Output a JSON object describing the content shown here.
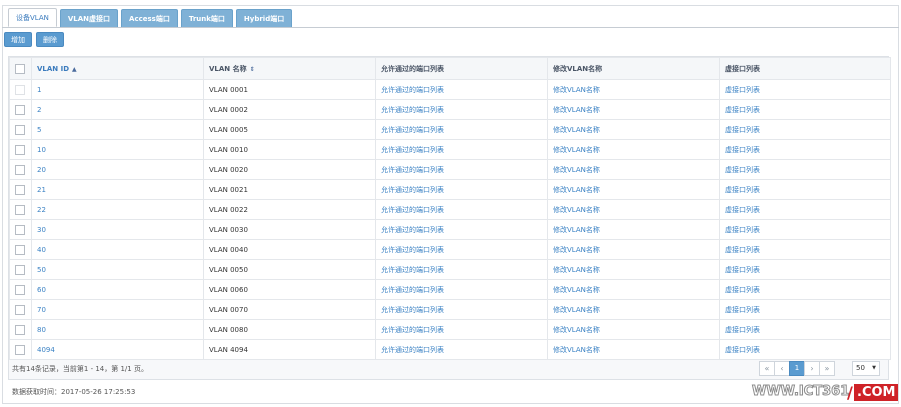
{
  "tabs": [
    "设备VLAN",
    "VLAN虚接口",
    "Access端口",
    "Trunk端口",
    "Hybrid端口"
  ],
  "toolbar": {
    "add": "增加",
    "delete": "删除"
  },
  "table": {
    "headers": [
      "VLAN ID",
      "VLAN 名称",
      "允许通过的端口列表",
      "修改VLAN名称",
      "虚接口列表"
    ],
    "sort_icons": [
      "▲",
      "⇕"
    ],
    "rows": [
      {
        "id": "1",
        "name": "VLAN 0001",
        "ports": "允许通过的端口列表",
        "edit": "修改VLAN名称",
        "vif": "虚接口列表"
      },
      {
        "id": "2",
        "name": "VLAN 0002",
        "ports": "允许通过的端口列表",
        "edit": "修改VLAN名称",
        "vif": "虚接口列表"
      },
      {
        "id": "5",
        "name": "VLAN 0005",
        "ports": "允许通过的端口列表",
        "edit": "修改VLAN名称",
        "vif": "虚接口列表"
      },
      {
        "id": "10",
        "name": "VLAN 0010",
        "ports": "允许通过的端口列表",
        "edit": "修改VLAN名称",
        "vif": "虚接口列表"
      },
      {
        "id": "20",
        "name": "VLAN 0020",
        "ports": "允许通过的端口列表",
        "edit": "修改VLAN名称",
        "vif": "虚接口列表"
      },
      {
        "id": "21",
        "name": "VLAN 0021",
        "ports": "允许通过的端口列表",
        "edit": "修改VLAN名称",
        "vif": "虚接口列表"
      },
      {
        "id": "22",
        "name": "VLAN 0022",
        "ports": "允许通过的端口列表",
        "edit": "修改VLAN名称",
        "vif": "虚接口列表"
      },
      {
        "id": "30",
        "name": "VLAN 0030",
        "ports": "允许通过的端口列表",
        "edit": "修改VLAN名称",
        "vif": "虚接口列表"
      },
      {
        "id": "40",
        "name": "VLAN 0040",
        "ports": "允许通过的端口列表",
        "edit": "修改VLAN名称",
        "vif": "虚接口列表"
      },
      {
        "id": "50",
        "name": "VLAN 0050",
        "ports": "允许通过的端口列表",
        "edit": "修改VLAN名称",
        "vif": "虚接口列表"
      },
      {
        "id": "60",
        "name": "VLAN 0060",
        "ports": "允许通过的端口列表",
        "edit": "修改VLAN名称",
        "vif": "虚接口列表"
      },
      {
        "id": "70",
        "name": "VLAN 0070",
        "ports": "允许通过的端口列表",
        "edit": "修改VLAN名称",
        "vif": "虚接口列表"
      },
      {
        "id": "80",
        "name": "VLAN 0080",
        "ports": "允许通过的端口列表",
        "edit": "修改VLAN名称",
        "vif": "虚接口列表"
      },
      {
        "id": "4094",
        "name": "VLAN 4094",
        "ports": "允许通过的端口列表",
        "edit": "修改VLAN名称",
        "vif": "虚接口列表"
      }
    ]
  },
  "summary": "共有14条记录，当前第1 - 14，第 1/1 页。",
  "pager": {
    "first": "«",
    "prev": "‹",
    "current": "1",
    "next": "›",
    "last": "»",
    "page_size": "50"
  },
  "fetch_time": "数据获取时间：2017-05-26 17:25:53",
  "watermark": {
    "main": "WWW.ICT361",
    "suffix": ".COM"
  },
  "colors": {
    "tab": "#7fb1d6",
    "button": "#5a9bd0",
    "link": "#3b82c4",
    "watermark_red": "#cf2227"
  }
}
